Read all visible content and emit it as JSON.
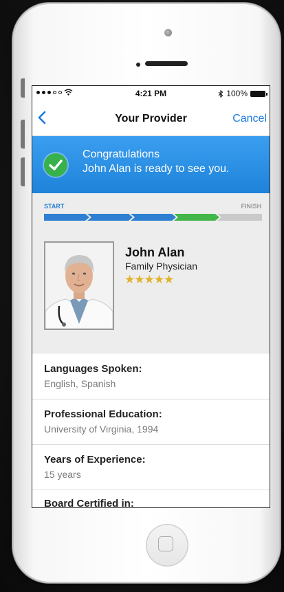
{
  "status_bar": {
    "time": "4:21 PM",
    "battery": "100%",
    "signal_dots_filled": 3,
    "signal_dots_total": 5,
    "bluetooth_icon": "bluetooth-icon",
    "wifi_icon": "wifi-icon"
  },
  "nav": {
    "back_icon": "chevron-left-icon",
    "title": "Your Provider",
    "cancel": "Cancel"
  },
  "banner": {
    "icon": "check-circle-icon",
    "title": "Congratulations",
    "subtitle": "John Alan is ready to see you."
  },
  "progress": {
    "start_label": "START",
    "finish_label": "FINISH",
    "steps_total": 5,
    "steps_done": 3,
    "current_step": 4
  },
  "provider": {
    "name": "John Alan",
    "specialty": "Family Physician",
    "rating": 5,
    "rating_max": 5,
    "stars": "★★★★★"
  },
  "details": [
    {
      "label": "Languages Spoken:",
      "value": "English, Spanish"
    },
    {
      "label": "Professional Education:",
      "value": "University of Virginia, 1994"
    },
    {
      "label": "Years of Experience:",
      "value": "15 years"
    },
    {
      "label": "Board Certified in:",
      "value": ""
    }
  ],
  "colors": {
    "accent_blue": "#1a7ae0",
    "banner_blue": "#2a8fe3",
    "progress_blue": "#2f7fd3",
    "progress_green": "#43b649",
    "progress_gray": "#c9c9c9",
    "star_gold": "#e1b32b"
  }
}
